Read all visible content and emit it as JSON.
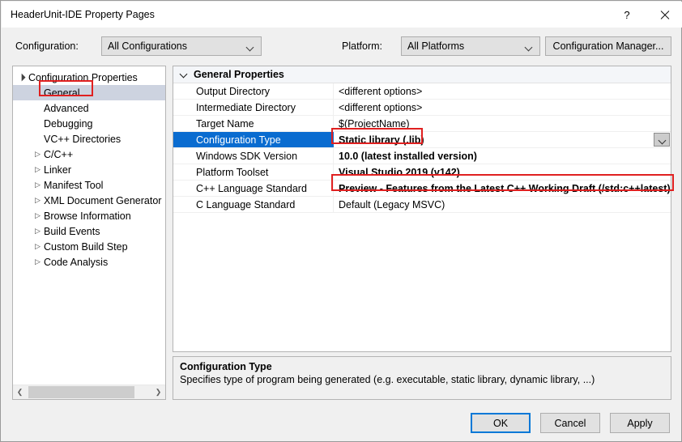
{
  "window": {
    "title": "HeaderUnit-IDE Property Pages",
    "help_label": "?",
    "close_label": "X"
  },
  "config_bar": {
    "configuration_label": "Configuration:",
    "configuration_value": "All Configurations",
    "platform_label": "Platform:",
    "platform_value": "All Platforms",
    "configuration_manager_label": "Configuration Manager..."
  },
  "tree": {
    "items": [
      {
        "label": "Configuration Properties",
        "level": 0,
        "twisty": "expanded",
        "selected": false
      },
      {
        "label": "General",
        "level": 1,
        "twisty": "none",
        "selected": true
      },
      {
        "label": "Advanced",
        "level": 1,
        "twisty": "none",
        "selected": false
      },
      {
        "label": "Debugging",
        "level": 1,
        "twisty": "none",
        "selected": false
      },
      {
        "label": "VC++ Directories",
        "level": 1,
        "twisty": "none",
        "selected": false
      },
      {
        "label": "C/C++",
        "level": 1,
        "twisty": "collapsed",
        "selected": false
      },
      {
        "label": "Linker",
        "level": 1,
        "twisty": "collapsed",
        "selected": false
      },
      {
        "label": "Manifest Tool",
        "level": 1,
        "twisty": "collapsed",
        "selected": false
      },
      {
        "label": "XML Document Generator",
        "level": 1,
        "twisty": "collapsed",
        "selected": false
      },
      {
        "label": "Browse Information",
        "level": 1,
        "twisty": "collapsed",
        "selected": false
      },
      {
        "label": "Build Events",
        "level": 1,
        "twisty": "collapsed",
        "selected": false
      },
      {
        "label": "Custom Build Step",
        "level": 1,
        "twisty": "collapsed",
        "selected": false
      },
      {
        "label": "Code Analysis",
        "level": 1,
        "twisty": "collapsed",
        "selected": false
      }
    ],
    "scrollbar": {
      "left_arrow": "❮",
      "right_arrow": "❯"
    }
  },
  "grid": {
    "category": "General Properties",
    "rows": [
      {
        "name": "Output Directory",
        "value": "<different options>",
        "bold": false,
        "selected": false,
        "dropdown": false
      },
      {
        "name": "Intermediate Directory",
        "value": "<different options>",
        "bold": false,
        "selected": false,
        "dropdown": false
      },
      {
        "name": "Target Name",
        "value": "$(ProjectName)",
        "bold": false,
        "selected": false,
        "dropdown": false
      },
      {
        "name": "Configuration Type",
        "value": "Static library (.lib)",
        "bold": true,
        "selected": true,
        "dropdown": true
      },
      {
        "name": "Windows SDK Version",
        "value": "10.0 (latest installed version)",
        "bold": true,
        "selected": false,
        "dropdown": false
      },
      {
        "name": "Platform Toolset",
        "value": "Visual Studio 2019 (v142)",
        "bold": true,
        "selected": false,
        "dropdown": false
      },
      {
        "name": "C++ Language Standard",
        "value": "Preview - Features from the Latest C++ Working Draft (/std:c++latest)",
        "bold": true,
        "selected": false,
        "dropdown": false
      },
      {
        "name": "C Language Standard",
        "value": "Default (Legacy MSVC)",
        "bold": false,
        "selected": false,
        "dropdown": false
      }
    ]
  },
  "description": {
    "title": "Configuration Type",
    "body": "Specifies type of program being generated (e.g. executable, static library, dynamic library, ...)"
  },
  "footer": {
    "ok_label": "OK",
    "cancel_label": "Cancel",
    "apply_label": "Apply"
  },
  "annotation_color": "#e02020"
}
